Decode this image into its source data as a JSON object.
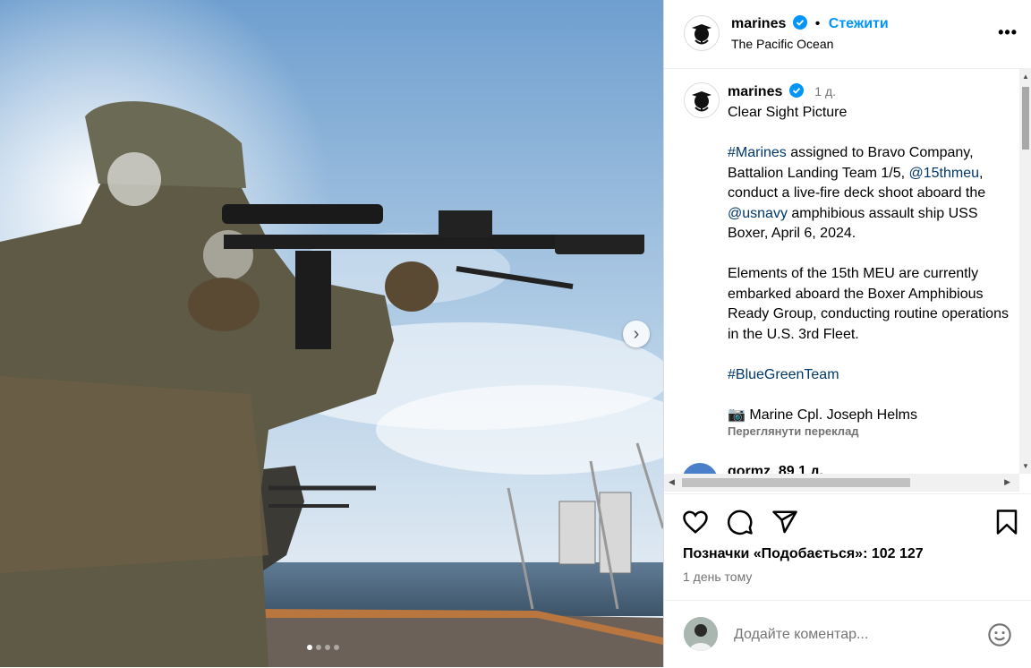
{
  "post": {
    "username": "marines",
    "follow_label": "Стежити",
    "location": "The Pacific Ocean",
    "more_label": "•••",
    "caption_time": "1 д.",
    "caption_lines": {
      "title": "Clear Sight Picture",
      "p1_tag": "#Marines",
      "p1_a": " assigned to Bravo Company, Battalion Landing Team 1/5, ",
      "p1_mention1": "@15thmeu",
      "p1_b": ", conduct a live-fire deck shoot aboard the ",
      "p1_mention2": "@usnavy",
      "p1_c": " amphibious assault ship USS Boxer, April 6, 2024.",
      "p2": "Elements of the 15th MEU are currently embarked aboard the Boxer Amphibious Ready Group, conducting routine operations in the U.S. 3rd Fleet.",
      "p3_tag": "#BlueGreenTeam",
      "p4_icon": "📷",
      "p4": " Marine Cpl. Joseph Helms"
    },
    "translate_label": "Переглянути переклад",
    "next_comment_user": "gormz_89 1 д.",
    "likes_label": "Позначки «Подобається»: ",
    "likes_count": "102 127",
    "posted_label": "1 день тому",
    "comment_placeholder": "Додайте коментар...",
    "carousel": {
      "slides": 4,
      "active": 1
    }
  },
  "colors": {
    "link": "#0095f6",
    "hashtag": "#00376b",
    "muted": "#737373"
  },
  "icons": {
    "like": "heart-icon",
    "comment": "comment-icon",
    "share": "send-icon",
    "save": "bookmark-icon",
    "emoji": "emoji-icon",
    "verified": "verified-badge-icon",
    "next": "chevron-right-icon"
  }
}
